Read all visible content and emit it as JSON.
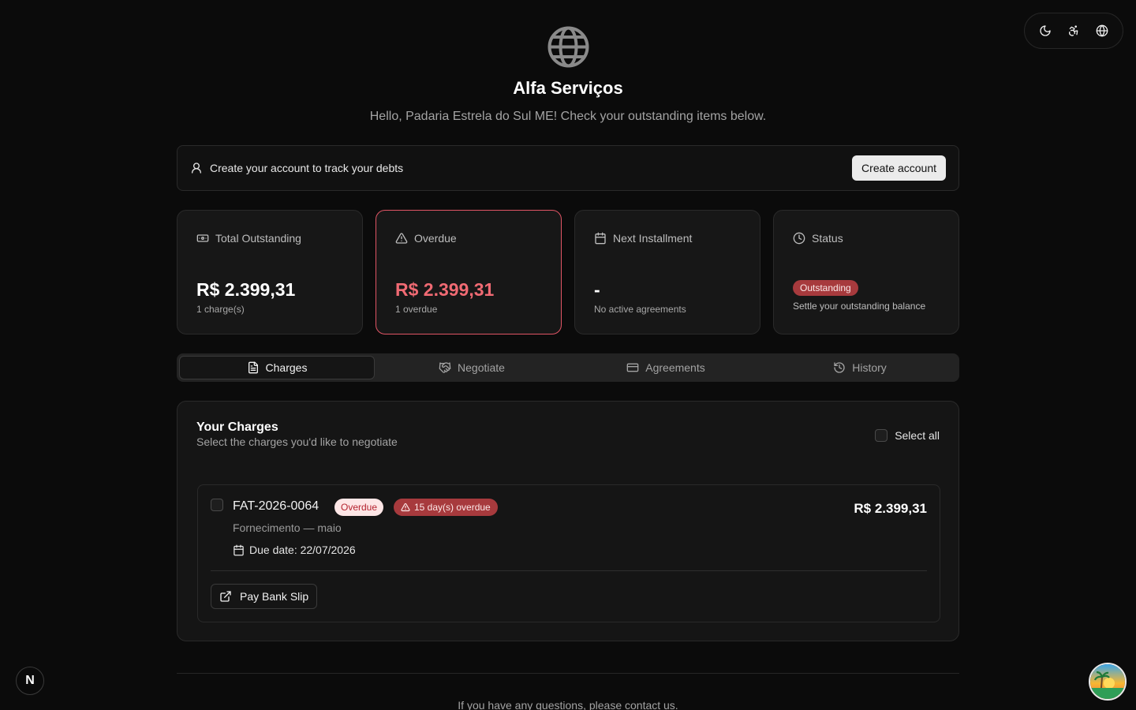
{
  "header": {
    "company_name": "Alfa Serviços",
    "greeting": "Hello, Padaria Estrela do Sul ME! Check your outstanding items below."
  },
  "toolbar": {
    "theme_icon": "moon-icon",
    "accessibility_icon": "accessibility-icon",
    "language_icon": "globe-icon"
  },
  "banner": {
    "text": "Create your account to track your debts",
    "button_label": "Create account"
  },
  "stats": {
    "total": {
      "label": "Total Outstanding",
      "value": "R$ 2.399,31",
      "sub": "1 charge(s)"
    },
    "overdue": {
      "label": "Overdue",
      "value": "R$ 2.399,31",
      "sub": "1 overdue"
    },
    "next": {
      "label": "Next Installment",
      "value": "-",
      "sub": "No active agreements"
    },
    "status": {
      "label": "Status",
      "badge": "Outstanding",
      "sub": "Settle your outstanding balance"
    }
  },
  "tabs": [
    {
      "label": "Charges",
      "active": true
    },
    {
      "label": "Negotiate",
      "active": false
    },
    {
      "label": "Agreements",
      "active": false
    },
    {
      "label": "History",
      "active": false
    }
  ],
  "charges": {
    "title": "Your Charges",
    "subtitle": "Select the charges you'd like to negotiate",
    "select_all_label": "Select all",
    "items": [
      {
        "id": "FAT-2026-0064",
        "status_badge": "Overdue",
        "days_badge": "15 day(s) overdue",
        "description": "Fornecimento — maio",
        "due": "Due date: 22/07/2026",
        "amount": "R$ 2.399,31",
        "pay_label": "Pay Bank Slip"
      }
    ]
  },
  "footer": {
    "text": "If you have any questions, please contact us."
  },
  "next_badge": "N",
  "colors": {
    "background": "#0b0b0b",
    "card": "#171717",
    "danger": "#f06a73",
    "danger_badge": "#a73a3d"
  }
}
